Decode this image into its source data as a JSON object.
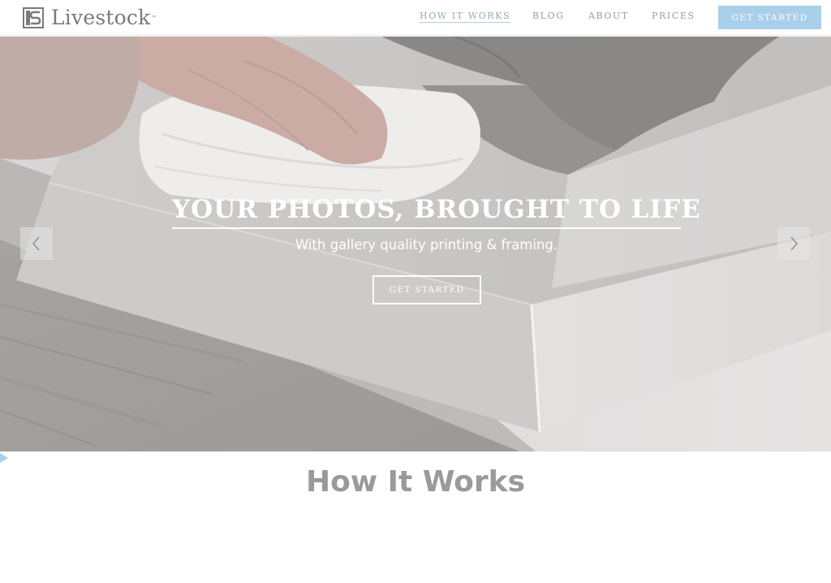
{
  "brand": {
    "name": "Livestock",
    "trademark": "™",
    "logo_icon": "ls-monogram-icon"
  },
  "nav": {
    "items": [
      {
        "label": "HOW IT WORKS",
        "active": true
      },
      {
        "label": "BLOG",
        "active": false
      },
      {
        "label": "ABOUT",
        "active": false
      },
      {
        "label": "PRICES",
        "active": false
      }
    ],
    "cta_label": "GET STARTED"
  },
  "hero": {
    "title": "YOUR PHOTOS, BROUGHT TO LIFE",
    "subtitle": "With gallery quality printing & framing.",
    "cta_label": "GET STARTED",
    "prev_icon": "chevron-left-icon",
    "next_icon": "chevron-right-icon"
  },
  "section": {
    "title": "How It Works"
  },
  "colors": {
    "accent": "#a9cfea",
    "nav_text": "#9a9a9a",
    "active_nav": "#93a9bd",
    "section_title": "#9a9a9a"
  }
}
